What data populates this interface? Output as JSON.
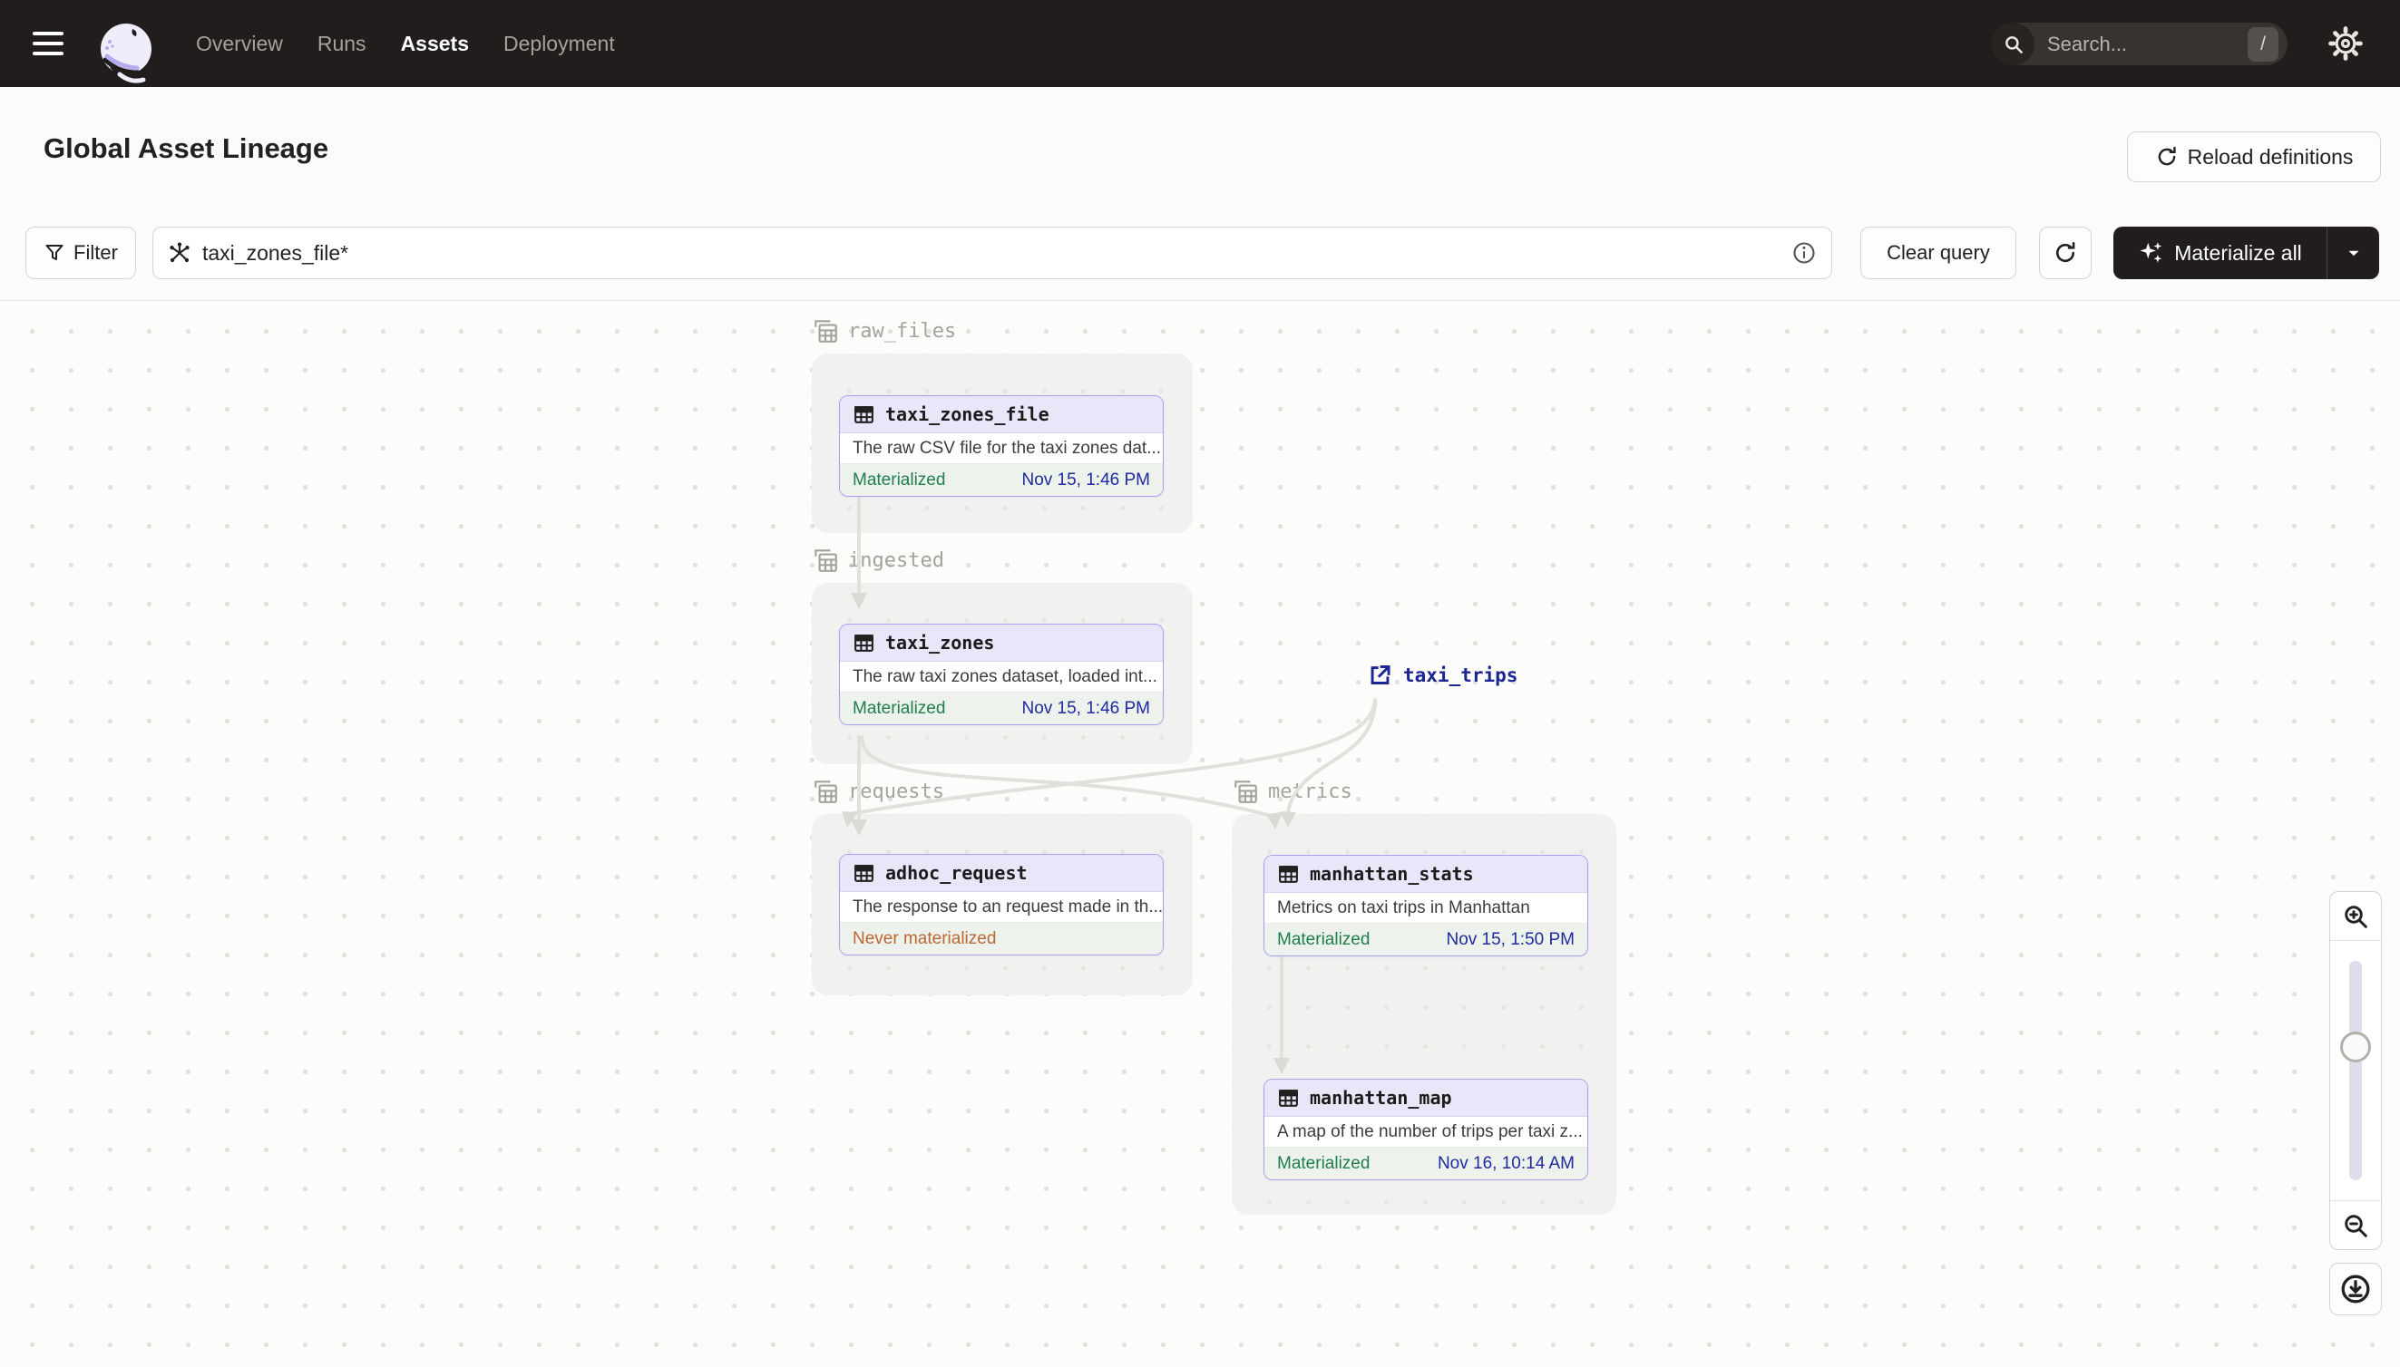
{
  "nav": {
    "links": [
      {
        "label": "Overview",
        "active": false
      },
      {
        "label": "Runs",
        "active": false
      },
      {
        "label": "Assets",
        "active": true
      },
      {
        "label": "Deployment",
        "active": false
      }
    ],
    "search": {
      "placeholder": "Search...",
      "shortcut": "/"
    }
  },
  "header": {
    "title": "Global Asset Lineage",
    "reload_button": "Reload definitions"
  },
  "toolbar": {
    "filter_button": "Filter",
    "query_value": "taxi_zones_file*",
    "clear_button": "Clear query",
    "materialize_button": "Materialize all"
  },
  "graph": {
    "groups": [
      {
        "label": "raw_files"
      },
      {
        "label": "ingested"
      },
      {
        "label": "requests"
      },
      {
        "label": "metrics"
      }
    ],
    "nodes": [
      {
        "name": "taxi_zones_file",
        "description": "The raw CSV file for the taxi zones dat...",
        "status": "Materialized",
        "timestamp": "Nov 15, 1:46 PM"
      },
      {
        "name": "taxi_zones",
        "description": "The raw taxi zones dataset, loaded int...",
        "status": "Materialized",
        "timestamp": "Nov 15, 1:46 PM"
      },
      {
        "name": "adhoc_request",
        "description": "The response to an request made in th...",
        "status": "Never materialized",
        "timestamp": ""
      },
      {
        "name": "manhattan_stats",
        "description": "Metrics on taxi trips in Manhattan",
        "status": "Materialized",
        "timestamp": "Nov 15, 1:50 PM"
      },
      {
        "name": "manhattan_map",
        "description": "A map of the number of trips per taxi z...",
        "status": "Materialized",
        "timestamp": "Nov 16, 10:14 AM"
      }
    ],
    "external_asset": {
      "name": "taxi_trips"
    },
    "edges": [
      {
        "from": "taxi_zones_file",
        "to": "taxi_zones"
      },
      {
        "from": "taxi_zones",
        "to": "adhoc_request"
      },
      {
        "from": "taxi_zones",
        "to": "manhattan_stats"
      },
      {
        "from": "taxi_trips",
        "to": "adhoc_request"
      },
      {
        "from": "taxi_trips",
        "to": "manhattan_stats"
      },
      {
        "from": "manhattan_stats",
        "to": "manhattan_map"
      }
    ]
  },
  "colors": {
    "navbar_bg": "#211D1C",
    "accent_purple": "#A89FF2",
    "node_header_bg": "#EAE6FA",
    "status_green": "#1E7E4D",
    "status_orange": "#BC6731",
    "timestamp_navy": "#1F2A9E",
    "edge_gray": "#E2E0DD"
  },
  "icons": {
    "menu": "hamburger",
    "logo": "dagster-octopus",
    "search": "magnifier",
    "shortcut": "/",
    "settings": "gear",
    "reload": "circular-arrow",
    "filter": "funnel",
    "query": "lineage-asterisk",
    "info": "info-circle",
    "refresh": "circular-arrow",
    "materialize": "sparkles",
    "caret": "chevron-down",
    "group": "layered-table",
    "asset": "table-grid",
    "external": "external-link",
    "zoom_in": "magnifier-plus",
    "zoom_out": "magnifier-minus",
    "download": "download-circle"
  }
}
